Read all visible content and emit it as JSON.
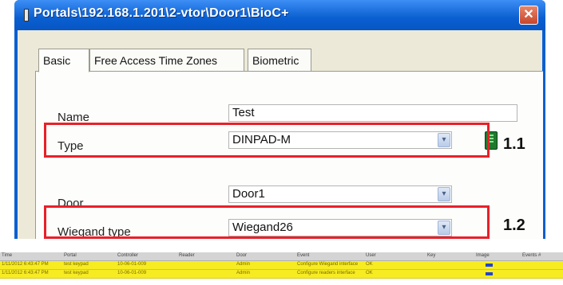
{
  "window": {
    "title": "Portals\\192.168.1.201\\2-vtor\\Door1\\BioC+",
    "close": "✕"
  },
  "tabs": [
    {
      "label": "Basic"
    },
    {
      "label": "Free Access Time Zones"
    },
    {
      "label": "Biometric"
    }
  ],
  "form": {
    "name_label": "Name",
    "name_value": "Test",
    "type_label": "Type",
    "type_value": "DINPAD-M",
    "door_label": "Door",
    "door_value": "Door1",
    "wiegand_label": "Wiegand type",
    "wiegand_value": "Wiegand26",
    "dropdown_arrow": "▾"
  },
  "callouts": [
    "1.1",
    "1.2"
  ],
  "colors": {
    "highlight": "#e8202a",
    "row_yellow": "#f7ec22",
    "titlebar": "#0a5fd0"
  },
  "event_grid": {
    "columns": [
      "Time",
      "Portal",
      "Controller",
      "Reader",
      "Door",
      "Event",
      "User",
      "Key",
      "Image",
      "Events #"
    ],
    "rows": [
      [
        "1/11/2012 6:43:47 PM",
        "test keypad",
        "10-06-01-009",
        "",
        "Admin",
        "Configure Wiegand interface",
        "OK",
        "",
        "",
        ""
      ],
      [
        "1/11/2012 6:43:47 PM",
        "test keypad",
        "10-06-01-009",
        "",
        "Admin",
        "Configure readers interface",
        "OK",
        "",
        "",
        ""
      ]
    ]
  }
}
